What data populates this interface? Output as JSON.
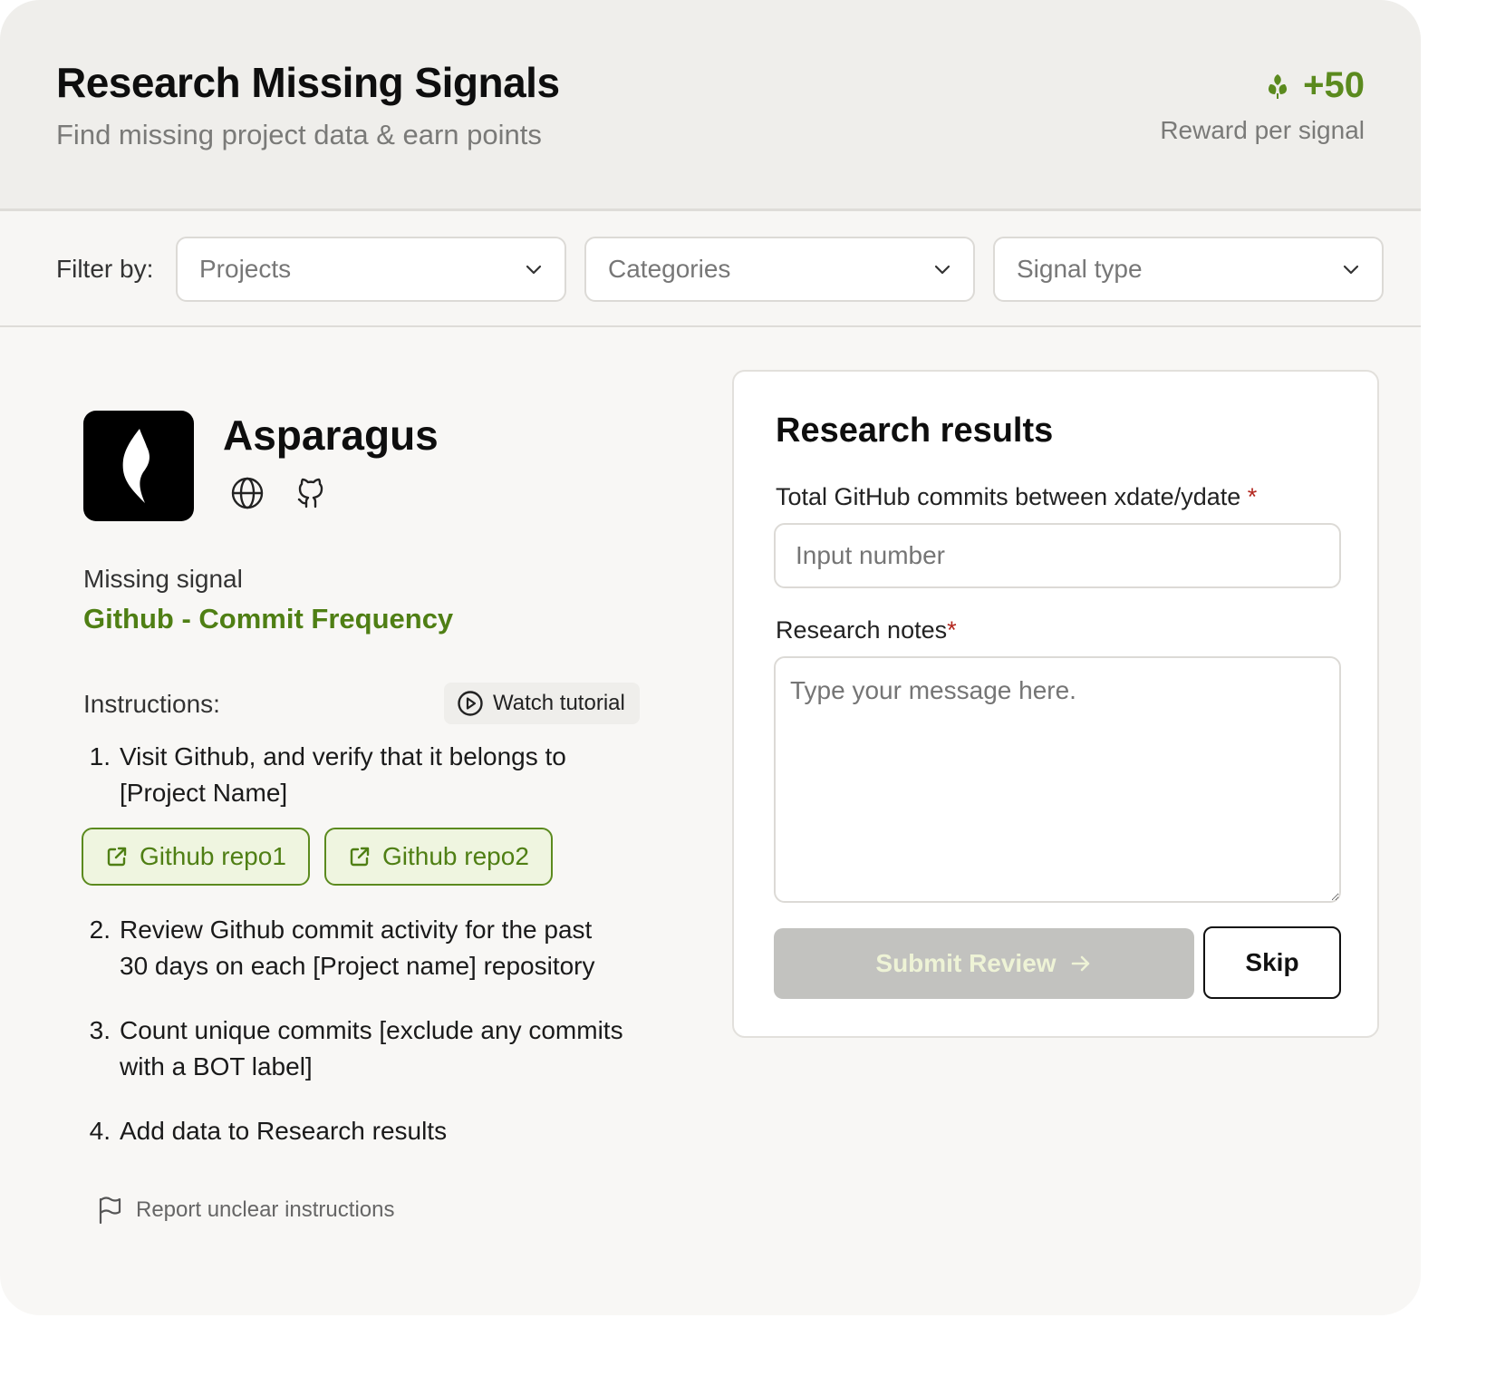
{
  "header": {
    "title": "Research Missing Signals",
    "subtitle": "Find missing project data & earn points",
    "reward_value": "+50",
    "reward_label": "Reward per signal",
    "reward_icon": "leaves-icon",
    "accent_color": "#5b8a1e"
  },
  "filters": {
    "label": "Filter by:",
    "selects": [
      {
        "placeholder": "Projects"
      },
      {
        "placeholder": "Categories"
      },
      {
        "placeholder": "Signal type"
      }
    ]
  },
  "project": {
    "name": "Asparagus",
    "links": [
      "globe-icon",
      "github-icon"
    ],
    "missing_label": "Missing signal",
    "missing_value": "Github - Commit Frequency"
  },
  "instructions": {
    "label": "Instructions:",
    "tutorial": "Watch tutorial",
    "steps": [
      {
        "num": "1.",
        "line1": "Visit Github, and verify that it belongs to",
        "line2": "[Project Name]"
      },
      {
        "num": "2.",
        "line1": "Review Github commit activity for the past",
        "line2": "30 days on each [Project name] repository"
      },
      {
        "num": "3.",
        "line1": "Count unique commits [exclude any commits",
        "line2": "with a BOT label]"
      },
      {
        "num": "4.",
        "line1": "Add data to Research results",
        "line2": ""
      }
    ],
    "repos": [
      "Github repo1",
      "Github repo2"
    ],
    "report": "Report unclear instructions"
  },
  "results": {
    "title": "Research results",
    "commits_label": "Total GitHub commits between xdate/ydate",
    "commits_placeholder": "Input number",
    "notes_label": "Research notes",
    "notes_placeholder": "Type your message here.",
    "required_mark": "*",
    "submit": "Submit Review",
    "skip": "Skip"
  }
}
